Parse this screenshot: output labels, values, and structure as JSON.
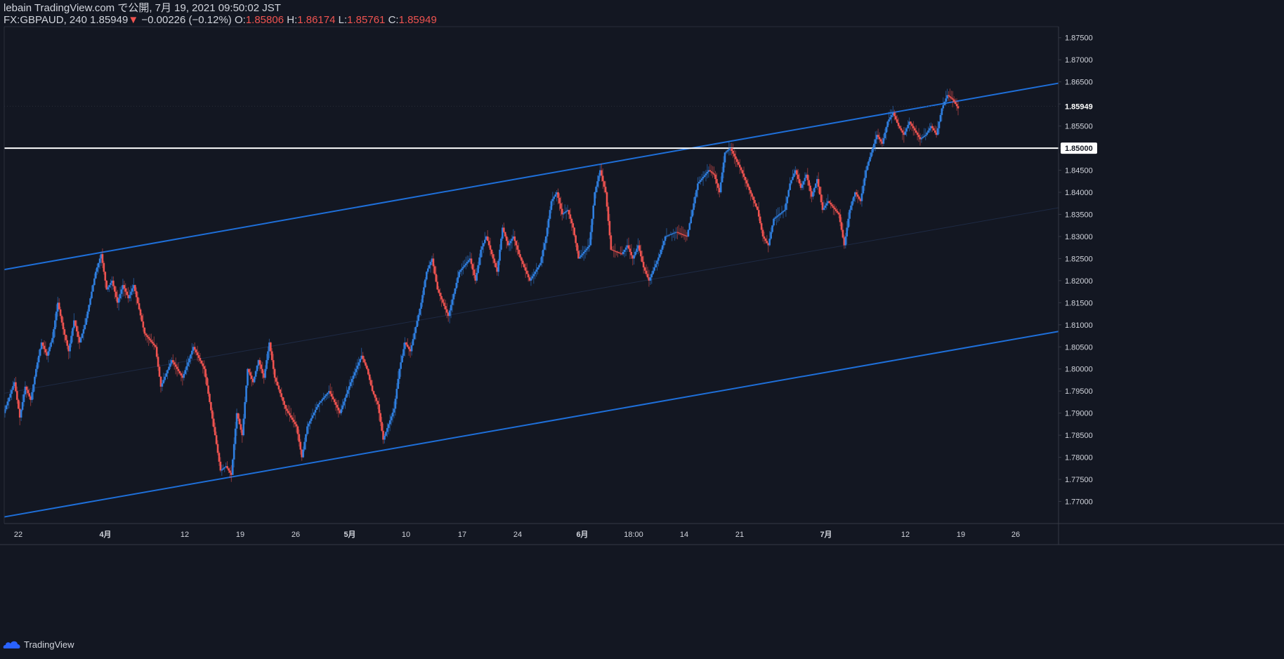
{
  "header": {
    "line1": "lebain TradingView.com で公開, 7月 19, 2021 09:50:02 JST",
    "symbol": "FX:GBPAUD, 240",
    "last": "1.85949",
    "change": "−0.00226 (−0.12%)",
    "o_label": "O:",
    "o_val": "1.85806",
    "h_label": "H:",
    "h_val": "1.86174",
    "l_label": "L:",
    "l_val": "1.85761",
    "c_label": "C:",
    "c_val": "1.85949"
  },
  "colors": {
    "background": "#131722",
    "up": "#2962ff",
    "up_candle": "#2f7fe0",
    "down": "#ef5350",
    "trendline": "#1e6fd9",
    "level": "#ffffff",
    "text": "#d1d4dc"
  },
  "footer": {
    "brand": "TradingView"
  },
  "chart_data": {
    "type": "candlestick",
    "symbol": "FX:GBPAUD",
    "timeframe": "240",
    "ylim": [
      1.765,
      1.8775
    ],
    "yticks": [
      "1.87500",
      "1.87000",
      "1.86500",
      "1.86000",
      "1.85500",
      "1.85000",
      "1.84500",
      "1.84000",
      "1.83500",
      "1.83000",
      "1.82500",
      "1.82000",
      "1.81500",
      "1.81000",
      "1.80500",
      "1.80000",
      "1.79500",
      "1.79000",
      "1.78500",
      "1.78000",
      "1.77500",
      "1.77000"
    ],
    "xticks": [
      "22",
      "4月",
      "12",
      "19",
      "26",
      "5月",
      "10",
      "17",
      "24",
      "6月",
      "18:00",
      "14",
      "21",
      "7月",
      "12",
      "19",
      "26"
    ],
    "last_price_label": "1.85949",
    "level_label": "1.85000",
    "horizontal_level": 1.85,
    "path_points": [
      [
        0,
        1.79
      ],
      [
        2,
        1.797
      ],
      [
        3,
        1.789
      ],
      [
        4,
        1.796
      ],
      [
        5,
        1.793
      ],
      [
        6,
        1.8
      ],
      [
        7,
        1.806
      ],
      [
        8,
        1.803
      ],
      [
        9,
        1.807
      ],
      [
        10,
        1.815
      ],
      [
        11,
        1.809
      ],
      [
        12,
        1.804
      ],
      [
        13,
        1.811
      ],
      [
        14,
        1.806
      ],
      [
        15,
        1.81
      ],
      [
        17,
        1.822
      ],
      [
        18,
        1.826
      ],
      [
        19,
        1.818
      ],
      [
        20,
        1.82
      ],
      [
        21,
        1.815
      ],
      [
        22,
        1.819
      ],
      [
        23,
        1.816
      ],
      [
        24,
        1.819
      ],
      [
        26,
        1.808
      ],
      [
        28,
        1.805
      ],
      [
        29,
        1.796
      ],
      [
        31,
        1.802
      ],
      [
        33,
        1.798
      ],
      [
        35,
        1.805
      ],
      [
        37,
        1.8
      ],
      [
        39,
        1.785
      ],
      [
        40,
        1.777
      ],
      [
        41,
        1.778
      ],
      [
        42,
        1.776
      ],
      [
        43,
        1.79
      ],
      [
        44,
        1.785
      ],
      [
        45,
        1.8
      ],
      [
        46,
        1.797
      ],
      [
        47,
        1.802
      ],
      [
        48,
        1.798
      ],
      [
        49,
        1.806
      ],
      [
        50,
        1.798
      ],
      [
        52,
        1.791
      ],
      [
        54,
        1.787
      ],
      [
        55,
        1.78
      ],
      [
        56,
        1.787
      ],
      [
        58,
        1.792
      ],
      [
        60,
        1.795
      ],
      [
        62,
        1.79
      ],
      [
        64,
        1.797
      ],
      [
        66,
        1.803
      ],
      [
        67,
        1.8
      ],
      [
        68,
        1.795
      ],
      [
        69,
        1.792
      ],
      [
        70,
        1.784
      ],
      [
        72,
        1.791
      ],
      [
        73,
        1.8
      ],
      [
        74,
        1.806
      ],
      [
        75,
        1.804
      ],
      [
        77,
        1.815
      ],
      [
        78,
        1.822
      ],
      [
        79,
        1.825
      ],
      [
        80,
        1.818
      ],
      [
        82,
        1.812
      ],
      [
        84,
        1.822
      ],
      [
        86,
        1.825
      ],
      [
        87,
        1.82
      ],
      [
        88,
        1.827
      ],
      [
        89,
        1.83
      ],
      [
        90,
        1.826
      ],
      [
        91,
        1.822
      ],
      [
        92,
        1.832
      ],
      [
        93,
        1.828
      ],
      [
        94,
        1.83
      ],
      [
        95,
        1.826
      ],
      [
        96,
        1.823
      ],
      [
        97,
        1.82
      ],
      [
        99,
        1.824
      ],
      [
        100,
        1.83
      ],
      [
        101,
        1.838
      ],
      [
        102,
        1.84
      ],
      [
        103,
        1.835
      ],
      [
        104,
        1.836
      ],
      [
        105,
        1.832
      ],
      [
        106,
        1.825
      ],
      [
        108,
        1.828
      ],
      [
        109,
        1.84
      ],
      [
        110,
        1.845
      ],
      [
        111,
        1.84
      ],
      [
        112,
        1.827
      ],
      [
        114,
        1.826
      ],
      [
        115,
        1.828
      ],
      [
        116,
        1.825
      ],
      [
        117,
        1.828
      ],
      [
        118,
        1.823
      ],
      [
        119,
        1.82
      ],
      [
        121,
        1.826
      ],
      [
        122,
        1.83
      ],
      [
        124,
        1.831
      ],
      [
        126,
        1.83
      ],
      [
        127,
        1.836
      ],
      [
        128,
        1.842
      ],
      [
        130,
        1.845
      ],
      [
        131,
        1.844
      ],
      [
        132,
        1.84
      ],
      [
        133,
        1.849
      ],
      [
        134,
        1.85
      ],
      [
        136,
        1.845
      ],
      [
        137,
        1.842
      ],
      [
        139,
        1.836
      ],
      [
        140,
        1.83
      ],
      [
        141,
        1.828
      ],
      [
        142,
        1.834
      ],
      [
        144,
        1.836
      ],
      [
        145,
        1.842
      ],
      [
        146,
        1.845
      ],
      [
        147,
        1.841
      ],
      [
        148,
        1.844
      ],
      [
        149,
        1.839
      ],
      [
        150,
        1.843
      ],
      [
        151,
        1.836
      ],
      [
        152,
        1.838
      ],
      [
        154,
        1.835
      ],
      [
        155,
        1.828
      ],
      [
        156,
        1.836
      ],
      [
        157,
        1.84
      ],
      [
        158,
        1.838
      ],
      [
        159,
        1.845
      ],
      [
        160,
        1.849
      ],
      [
        161,
        1.853
      ],
      [
        162,
        1.851
      ],
      [
        163,
        1.856
      ],
      [
        164,
        1.858
      ],
      [
        165,
        1.855
      ],
      [
        166,
        1.853
      ],
      [
        167,
        1.856
      ],
      [
        168,
        1.854
      ],
      [
        169,
        1.852
      ],
      [
        170,
        1.853
      ],
      [
        171,
        1.855
      ],
      [
        172,
        1.853
      ],
      [
        173,
        1.859
      ],
      [
        174,
        1.862
      ],
      [
        175,
        1.861
      ],
      [
        176,
        1.859
      ]
    ],
    "trendlines": [
      {
        "name": "upper channel",
        "from": [
          "2021-03-19",
          1.8225
        ],
        "to": [
          "2021-07-30",
          1.8647
        ]
      },
      {
        "name": "lower channel",
        "from": [
          "2021-03-19",
          1.7665
        ],
        "to": [
          "2021-07-30",
          1.8085
        ]
      },
      {
        "name": "mid channel",
        "from": [
          "2021-03-19",
          1.7945
        ],
        "to": [
          "2021-07-30",
          1.8365
        ]
      }
    ],
    "grid": false,
    "legend": "top-left"
  }
}
